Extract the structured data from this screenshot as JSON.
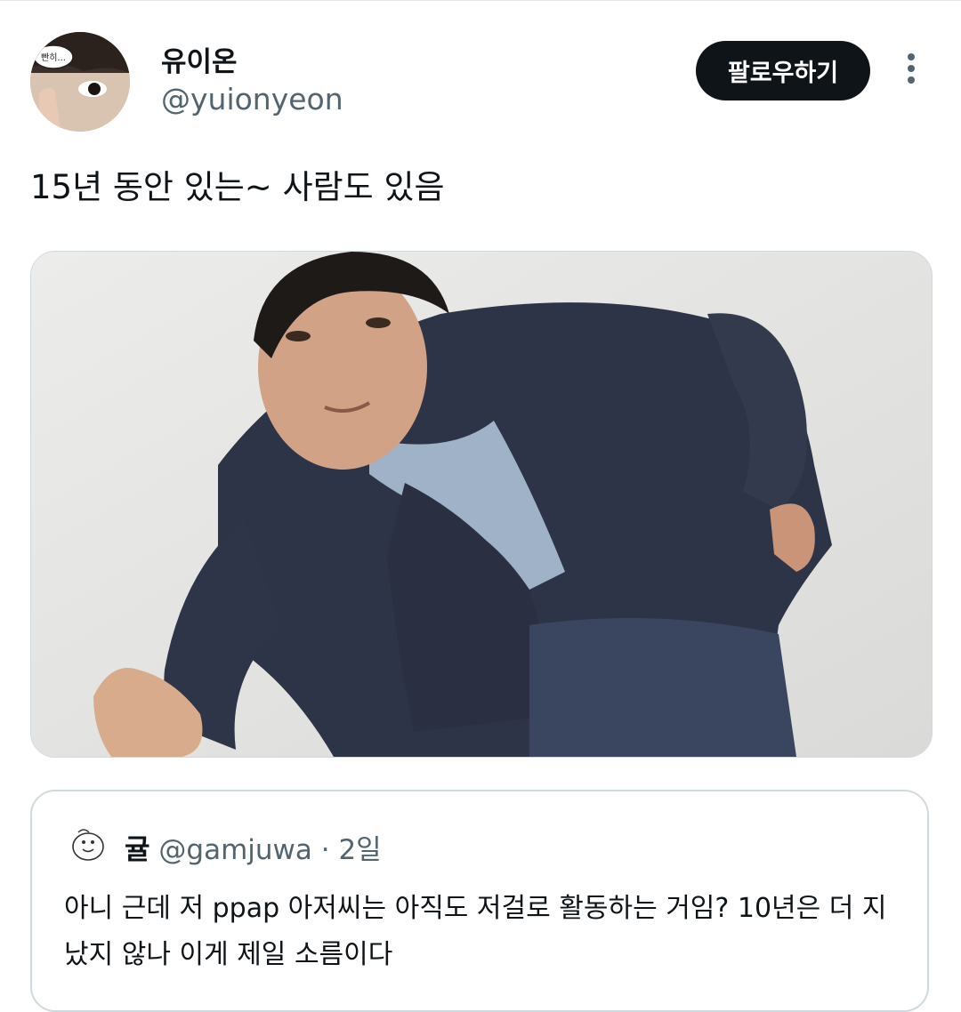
{
  "author": {
    "display_name": "유이온",
    "handle": "@yuionyeon",
    "avatar_badge": "빤히..."
  },
  "follow_button_label": "팔로우하기",
  "more_icon": "more-vertical-icon",
  "tweet": {
    "text": "15년 동안 있는~ 사람도 있음"
  },
  "quoted_tweet": {
    "display_name": "귤",
    "handle": "@gamjuwa",
    "separator": "·",
    "time": "2일",
    "text": "아니 근데 저 ppap 아저씨는 아직도 저걸로 활동하는 거임? 10년은 더 지났지 않나 이게 제일 소름이다"
  },
  "colors": {
    "text": "#0f1419",
    "secondary": "#536471",
    "border": "#cfd9de",
    "button_bg": "#0f1419",
    "button_text": "#ffffff"
  }
}
